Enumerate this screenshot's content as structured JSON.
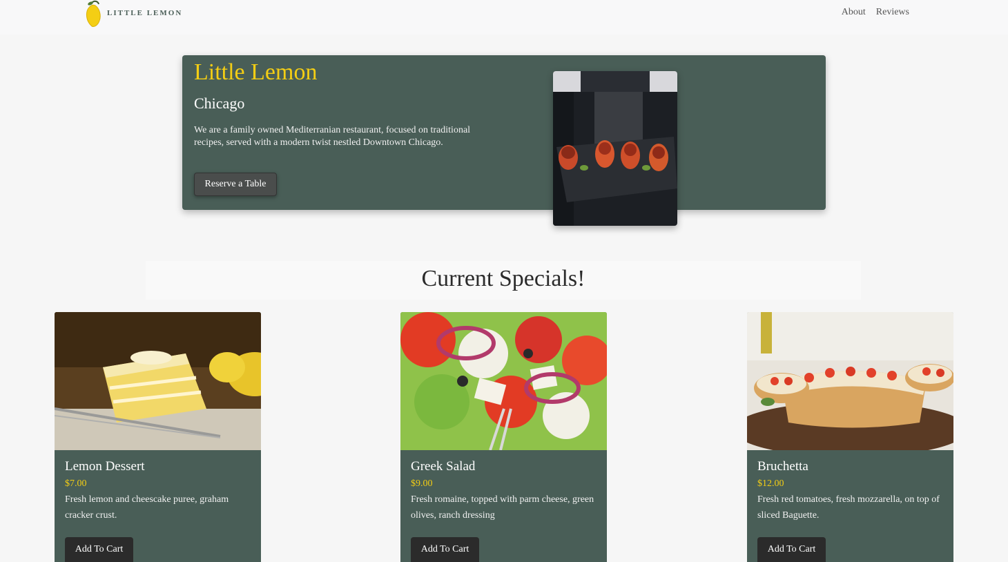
{
  "header": {
    "logo_text": "LITTLE LEMON",
    "nav": [
      {
        "label": "About"
      },
      {
        "label": "Reviews"
      }
    ]
  },
  "hero": {
    "title": "Little Lemon",
    "subtitle": "Chicago",
    "description": "We are a family owned Mediterranian restaurant, focused on traditional recipes, served with a modern twist nestled Downtown Chicago.",
    "button_label": "Reserve a Table"
  },
  "specials": {
    "title": "Current Specials!",
    "items": [
      {
        "name": "Lemon Dessert",
        "price": "$7.00",
        "description": "Fresh lemon and cheescake puree, graham cracker crust.",
        "button_label": "Add To Cart"
      },
      {
        "name": "Greek Salad",
        "price": "$9.00",
        "description": "Fresh romaine, topped with parm cheese, green olives, ranch dressing",
        "button_label": "Add To Cart"
      },
      {
        "name": "Bruchetta",
        "price": "$12.00",
        "description": "Fresh red tomatoes, fresh mozzarella, on top of sliced Baguette.",
        "button_label": "Add To Cart"
      }
    ]
  },
  "colors": {
    "primary_green": "#495e57",
    "accent_yellow": "#f4ce14",
    "dark_button": "#2b2b2b"
  }
}
